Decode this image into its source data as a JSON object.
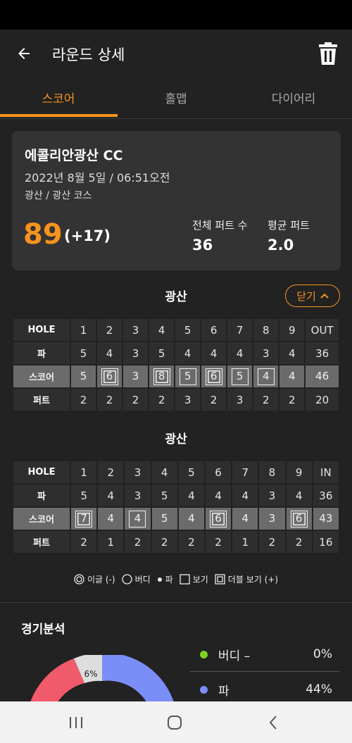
{
  "header": {
    "title": "라운드 상세"
  },
  "tabs": [
    {
      "label": "스코어",
      "active": true
    },
    {
      "label": "홀맵",
      "active": false
    },
    {
      "label": "다이어리",
      "active": false
    }
  ],
  "summary": {
    "course_name": "에콜리안광산 CC",
    "date": "2022년 8월 5일 / 06:51오전",
    "course_sub": "광산 / 광산 코스",
    "total_score": "89",
    "over_par": "(+17)",
    "total_putts_label": "전체 퍼트 수",
    "total_putts": "36",
    "avg_putt_label": "평균 퍼트",
    "avg_putt": "2.0"
  },
  "front": {
    "title": "광산",
    "close_label": "닫기",
    "hole_label": "HOLE",
    "holes": [
      "1",
      "2",
      "3",
      "4",
      "5",
      "6",
      "7",
      "8",
      "9",
      "OUT"
    ],
    "par_label": "파",
    "pars": [
      "5",
      "4",
      "3",
      "5",
      "4",
      "4",
      "4",
      "3",
      "4",
      "36"
    ],
    "score_label": "스코어",
    "scores": [
      "5",
      "6",
      "3",
      "8",
      "5",
      "6",
      "5",
      "4",
      "4",
      "46"
    ],
    "score_marks": [
      "none",
      "double",
      "none",
      "double",
      "bogey",
      "double",
      "bogey",
      "bogey",
      "none",
      "none"
    ],
    "putt_label": "퍼트",
    "putts": [
      "2",
      "2",
      "2",
      "2",
      "3",
      "2",
      "3",
      "2",
      "2",
      "20"
    ]
  },
  "back": {
    "title": "광산",
    "hole_label": "HOLE",
    "holes": [
      "1",
      "2",
      "3",
      "4",
      "5",
      "6",
      "7",
      "8",
      "9",
      "IN"
    ],
    "par_label": "파",
    "pars": [
      "5",
      "4",
      "3",
      "5",
      "4",
      "4",
      "4",
      "3",
      "4",
      "36"
    ],
    "score_label": "스코어",
    "scores": [
      "7",
      "4",
      "4",
      "5",
      "4",
      "6",
      "4",
      "3",
      "6",
      "43"
    ],
    "score_marks": [
      "double",
      "none",
      "bogey",
      "none",
      "none",
      "double",
      "none",
      "none",
      "double",
      "none"
    ],
    "putt_label": "퍼트",
    "putts": [
      "2",
      "1",
      "2",
      "2",
      "2",
      "2",
      "1",
      "2",
      "2",
      "16"
    ]
  },
  "legend": [
    {
      "icon": "double-circle-icon",
      "label": "이글 (-)"
    },
    {
      "icon": "circle-icon",
      "label": "버디"
    },
    {
      "icon": "dot-icon",
      "label": "파"
    },
    {
      "icon": "square-icon",
      "label": "보기"
    },
    {
      "icon": "double-square-icon",
      "label": "더블 보기 (+)"
    }
  ],
  "analysis": {
    "title": "경기분석",
    "donut_label": "6%",
    "stats": [
      {
        "label": "버디 –",
        "pct": "0%",
        "color": "#7ed321"
      },
      {
        "label": "파",
        "pct": "44%",
        "color": "#7b8ef7"
      }
    ],
    "donut_colors": {
      "par": "#7b8ef7",
      "bogey": "#f05a6a",
      "other": "#dddddd"
    }
  },
  "colors": {
    "accent": "#f7931e",
    "background": "#222222",
    "card": "#333333"
  }
}
